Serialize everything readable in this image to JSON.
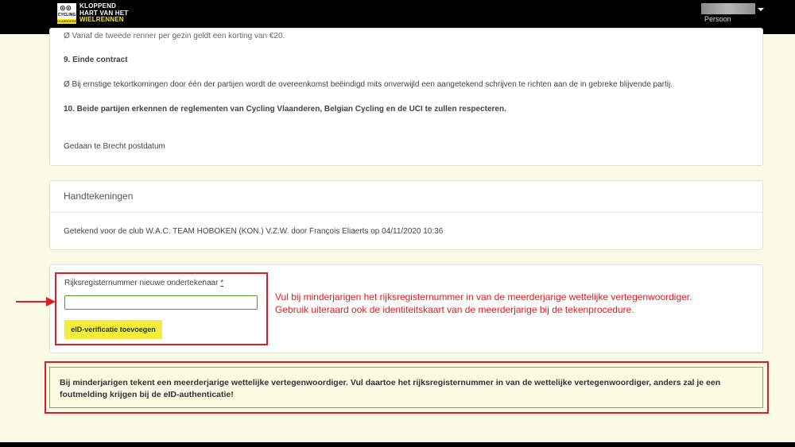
{
  "header": {
    "logo": {
      "line1": "KLOPPEND",
      "line2": "HART VAN HET",
      "line3": "WIELRENNEN",
      "mark_top": "CYCLING",
      "mark_bottom": "VLAANDEREN"
    },
    "user_role": "Persoon"
  },
  "contract": {
    "cutoff_line": "Ø  Vanaf de tweede renner per gezin geldt een korting van €20.",
    "section9_title": "9.   Einde contract",
    "section9_text": "Ø  Bij ernstige tekortkomingen door één der partijen wordt de overeenkomst beëindigd mits onverwijld een aangetekend schrijven te richten aan de in gebreke blijvende partij.",
    "section10_title": "10.  Beide partijen erkennen de reglementen van Cycling Vlaanderen, Belgian Cycling en de UCI te zullen respecteren.",
    "place_date": "Gedaan te Brecht postdatum"
  },
  "signatures": {
    "title": "Handtekeningen",
    "entry": "Getekend voor de club W.A.C. TEAM HOBOKEN (KON.) V.Z.W. door François Eliaerts op 04/11/2020 10:36"
  },
  "form": {
    "label": "Rijksregisternummer nieuwe ondertekenaar",
    "required_mark": "*",
    "input_value": "",
    "button_label": "eID-verificatie toevoegen"
  },
  "annotation": {
    "line1": "Vul bij minderjarigen het rijksregisternummer in van de meerderjarige wettelijke vertegenwoordiger.",
    "line2": "Gebruik uiteraard ook de identiteitskaart van de meerderjarige bij de tekenprocedure."
  },
  "warning": {
    "text": "Bij minderjarigen tekent een meerderjarige wettelijke vertegenwoordiger. Vul daartoe het rijksregisternummer in van de wettelijke vertegenwoordiger, anders zal je een foutmelding krijgen bij de eID-authenticatie!"
  },
  "colors": {
    "background": "#fbfbe6",
    "accent_yellow": "#f3ee3c",
    "annotation_red": "#e01b24",
    "topbar": "#000000"
  }
}
